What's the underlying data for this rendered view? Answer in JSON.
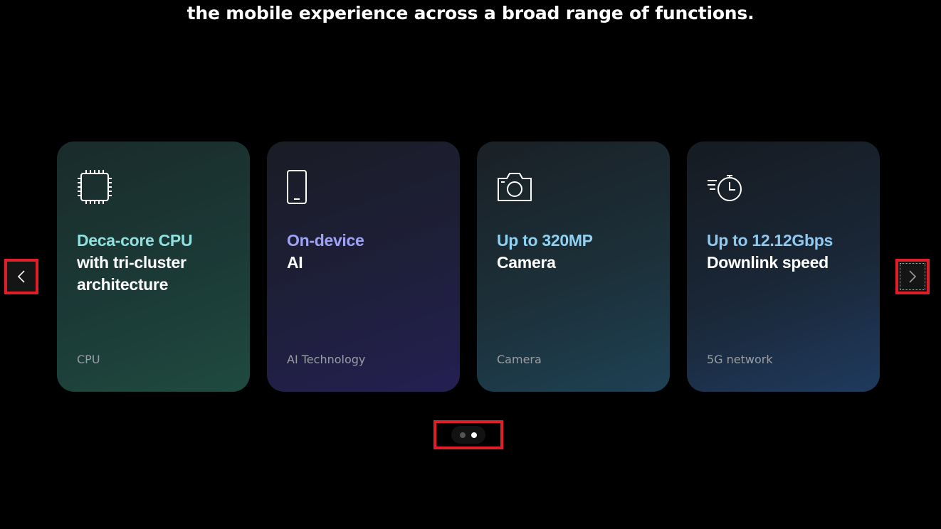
{
  "headline": "the mobile experience across a broad range of functions.",
  "cards": [
    {
      "accent": "Deca-core CPU",
      "line1": "with tri-cluster",
      "line2": "architecture",
      "category": "CPU",
      "icon": "cpu-chip-icon"
    },
    {
      "accent": "On-device",
      "line1": "AI",
      "line2": "",
      "category": "AI Technology",
      "icon": "smartphone-icon"
    },
    {
      "accent": "Up to 320MP",
      "line1": "Camera",
      "line2": "",
      "category": "Camera",
      "icon": "camera-icon"
    },
    {
      "accent": "Up to 12.12Gbps",
      "line1": "Downlink speed",
      "line2": "",
      "category": "5G network",
      "icon": "stopwatch-speed-icon"
    }
  ],
  "navigation": {
    "prev_icon": "chevron-left-icon",
    "next_icon": "chevron-right-icon"
  },
  "pagination": {
    "total": 2,
    "active": 2
  },
  "colors": {
    "background": "#000000",
    "highlight_outline": "#e01e2a",
    "accent_cpu": "#8fe0df",
    "accent_ai": "#9ea3f7",
    "accent_camera": "#8fd1f0",
    "accent_5g": "#90c8ef"
  }
}
